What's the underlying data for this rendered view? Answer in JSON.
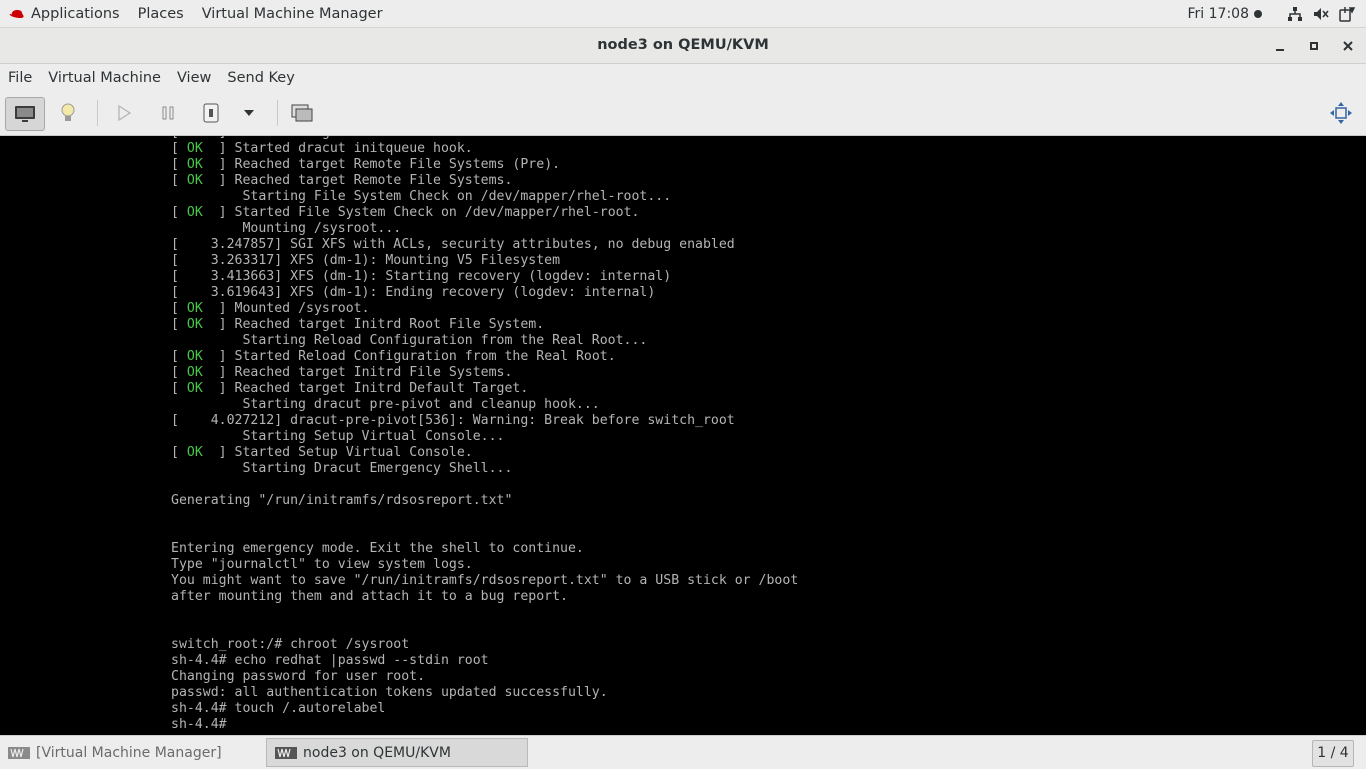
{
  "topbar": {
    "applications": "Applications",
    "places": "Places",
    "vmm": "Virtual Machine Manager",
    "clock": "Fri 17:08",
    "tray_icons": [
      "network-icon",
      "volume-icon",
      "power-icon"
    ]
  },
  "window": {
    "title": "node3 on QEMU/KVM"
  },
  "menubar": {
    "file": "File",
    "vm": "Virtual Machine",
    "view": "View",
    "sendkey": "Send Key"
  },
  "toolbar": {
    "buttons": [
      "console-view",
      "details-view",
      "run",
      "pause",
      "shutdown",
      "shutdown-menu",
      "snapshots",
      "fullscreen"
    ]
  },
  "console": {
    "lines": [
      {
        "status": "OK",
        "text": " Reached target Initrd Root Device."
      },
      {
        "status": "OK",
        "text": " Started dracut initqueue hook."
      },
      {
        "status": "OK",
        "text": " Reached target Remote File Systems (Pre)."
      },
      {
        "status": "OK",
        "text": " Reached target Remote File Systems."
      },
      {
        "status": "",
        "text": "         Starting File System Check on /dev/mapper/rhel-root..."
      },
      {
        "status": "OK",
        "text": " Started File System Check on /dev/mapper/rhel-root."
      },
      {
        "status": "",
        "text": "         Mounting /sysroot..."
      },
      {
        "status": "",
        "text": "[    3.247857] SGI XFS with ACLs, security attributes, no debug enabled"
      },
      {
        "status": "",
        "text": "[    3.263317] XFS (dm-1): Mounting V5 Filesystem"
      },
      {
        "status": "",
        "text": "[    3.413663] XFS (dm-1): Starting recovery (logdev: internal)"
      },
      {
        "status": "",
        "text": "[    3.619643] XFS (dm-1): Ending recovery (logdev: internal)"
      },
      {
        "status": "OK",
        "text": " Mounted /sysroot."
      },
      {
        "status": "OK",
        "text": " Reached target Initrd Root File System."
      },
      {
        "status": "",
        "text": "         Starting Reload Configuration from the Real Root..."
      },
      {
        "status": "OK",
        "text": " Started Reload Configuration from the Real Root."
      },
      {
        "status": "OK",
        "text": " Reached target Initrd File Systems."
      },
      {
        "status": "OK",
        "text": " Reached target Initrd Default Target."
      },
      {
        "status": "",
        "text": "         Starting dracut pre-pivot and cleanup hook..."
      },
      {
        "status": "",
        "text": "[    4.027212] dracut-pre-pivot[536]: Warning: Break before switch_root"
      },
      {
        "status": "",
        "text": "         Starting Setup Virtual Console..."
      },
      {
        "status": "OK",
        "text": " Started Setup Virtual Console."
      },
      {
        "status": "",
        "text": "         Starting Dracut Emergency Shell..."
      },
      {
        "status": "",
        "text": ""
      },
      {
        "status": "",
        "text": "Generating \"/run/initramfs/rdsosreport.txt\""
      },
      {
        "status": "",
        "text": ""
      },
      {
        "status": "",
        "text": ""
      },
      {
        "status": "",
        "text": "Entering emergency mode. Exit the shell to continue."
      },
      {
        "status": "",
        "text": "Type \"journalctl\" to view system logs."
      },
      {
        "status": "",
        "text": "You might want to save \"/run/initramfs/rdsosreport.txt\" to a USB stick or /boot"
      },
      {
        "status": "",
        "text": "after mounting them and attach it to a bug report."
      },
      {
        "status": "",
        "text": ""
      },
      {
        "status": "",
        "text": ""
      },
      {
        "status": "",
        "text": "switch_root:/# chroot /sysroot"
      },
      {
        "status": "",
        "text": "sh-4.4# echo redhat |passwd --stdin root"
      },
      {
        "status": "",
        "text": "Changing password for user root."
      },
      {
        "status": "",
        "text": "passwd: all authentication tokens updated successfully."
      },
      {
        "status": "",
        "text": "sh-4.4# touch /.autorelabel"
      },
      {
        "status": "",
        "text": "sh-4.4#"
      }
    ]
  },
  "taskbar": {
    "task1": "[Virtual Machine Manager]",
    "task2": "node3 on QEMU/KVM",
    "pager": "1 / 4"
  }
}
